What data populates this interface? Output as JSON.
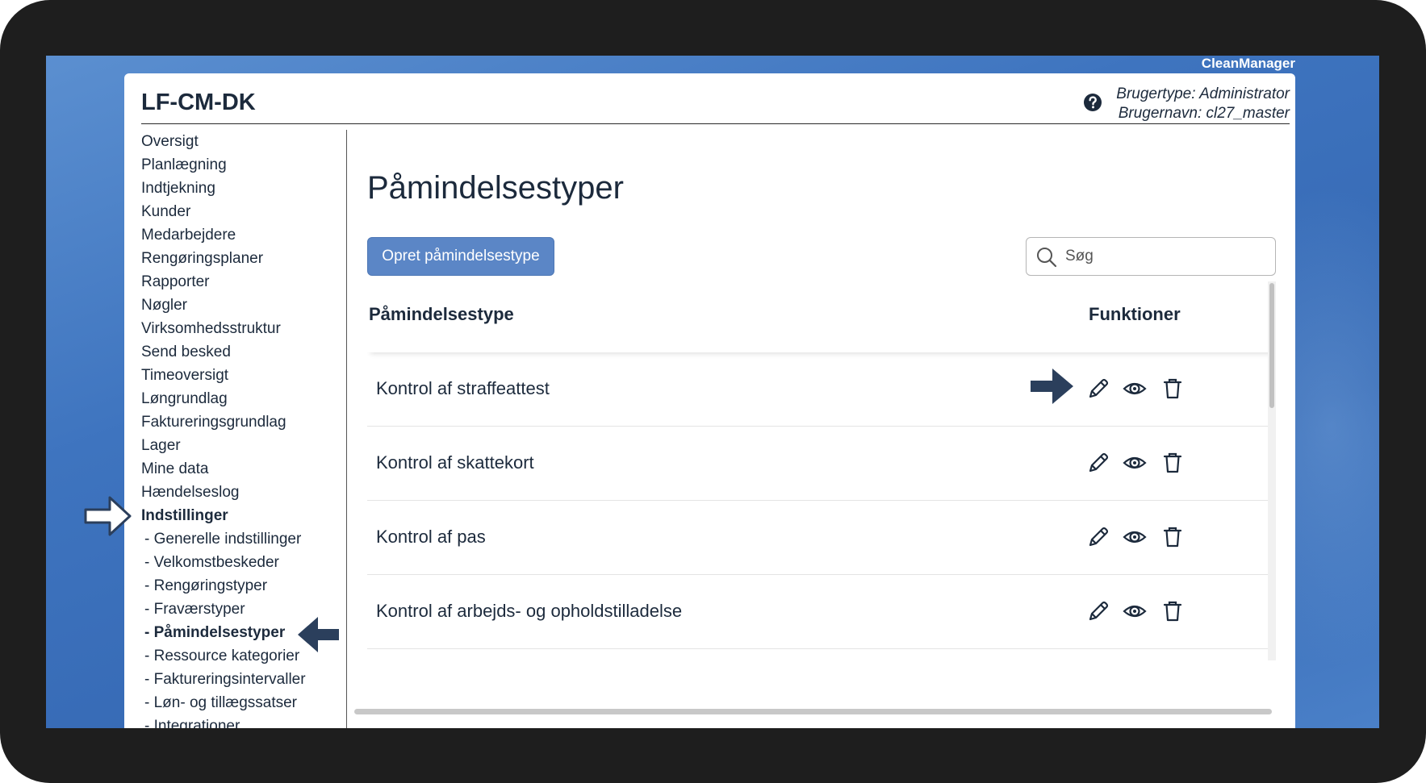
{
  "brand": "CleanManager",
  "header": {
    "org_name": "LF-CM-DK",
    "user_type": "Brugertype: Administrator",
    "user_name": "Brugernavn: cl27_master"
  },
  "sidebar": {
    "items": [
      {
        "label": "Oversigt",
        "active": false
      },
      {
        "label": "Planlægning",
        "active": false
      },
      {
        "label": "Indtjekning",
        "active": false
      },
      {
        "label": "Kunder",
        "active": false
      },
      {
        "label": "Medarbejdere",
        "active": false
      },
      {
        "label": "Rengøringsplaner",
        "active": false
      },
      {
        "label": "Rapporter",
        "active": false
      },
      {
        "label": "Nøgler",
        "active": false
      },
      {
        "label": "Virksomhedsstruktur",
        "active": false
      },
      {
        "label": "Send besked",
        "active": false
      },
      {
        "label": "Timeoversigt",
        "active": false
      },
      {
        "label": "Løngrundlag",
        "active": false
      },
      {
        "label": "Faktureringsgrundlag",
        "active": false
      },
      {
        "label": "Lager",
        "active": false
      },
      {
        "label": "Mine data",
        "active": false
      },
      {
        "label": "Hændelseslog",
        "active": false
      },
      {
        "label": "Indstillinger",
        "active": true
      }
    ],
    "sub_items": [
      {
        "label": "- Generelle indstillinger",
        "active": false
      },
      {
        "label": "- Velkomstbeskeder",
        "active": false
      },
      {
        "label": "- Rengøringstyper",
        "active": false
      },
      {
        "label": "- Fraværstyper",
        "active": false
      },
      {
        "label": "- Påmindelsestyper",
        "active": true
      },
      {
        "label": "- Ressource kategorier",
        "active": false
      },
      {
        "label": "- Faktureringsintervaller",
        "active": false
      },
      {
        "label": "- Løn- og tillægssatser",
        "active": false
      },
      {
        "label": "- Integrationer",
        "active": false
      }
    ]
  },
  "main": {
    "title": "Påmindelsestyper",
    "create_label": "Opret påmindelsestype",
    "search_placeholder": "Søg",
    "columns": {
      "type": "Påmindelsestype",
      "functions": "Funktioner"
    },
    "rows": [
      {
        "label": "Kontrol af straffeattest"
      },
      {
        "label": "Kontrol af skattekort"
      },
      {
        "label": "Kontrol af pas"
      },
      {
        "label": "Kontrol af arbejds- og opholdstilladelse"
      }
    ]
  },
  "icons": {
    "help": "question-circle-icon",
    "search": "magnifier-icon",
    "edit": "pencil-icon",
    "view": "eye-icon",
    "delete": "trash-icon",
    "guide": "arrow-icon"
  },
  "colors": {
    "accent": "#5b86c6",
    "text": "#1c2a3c",
    "guide_arrow": "#2b3f5c",
    "desktop": "#3e74bf",
    "bezel": "#1e1e1e"
  }
}
